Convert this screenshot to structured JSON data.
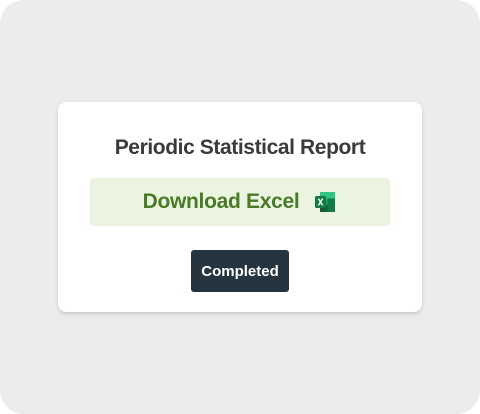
{
  "report": {
    "title": "Periodic Statistical Report",
    "download_label": "Download Excel",
    "download_icon": "excel-icon",
    "status_label": "Completed"
  },
  "colors": {
    "background": "#ececec",
    "card": "#ffffff",
    "title_text": "#3a3a3a",
    "download_bg": "#eaf4e0",
    "download_text": "#4a7a28",
    "status_bg": "#263440",
    "status_text": "#ffffff"
  }
}
